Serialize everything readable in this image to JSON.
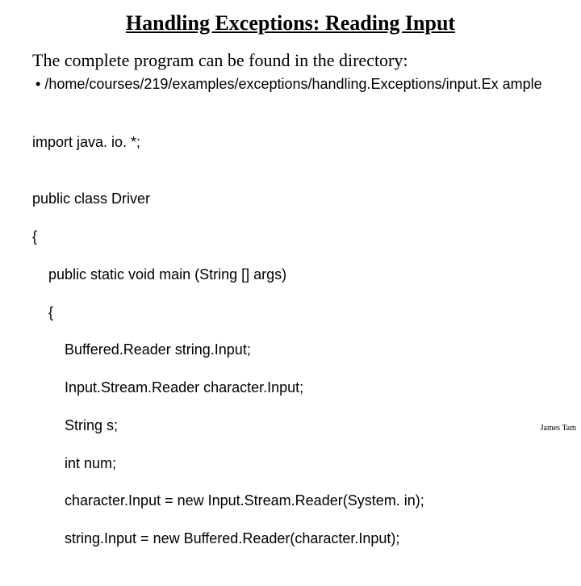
{
  "title": "Handling Exceptions: Reading Input",
  "intro": "The complete program can be found in the directory:",
  "bullet": "/home/courses/219/examples/exceptions/handling.Exceptions/input.Ex ample",
  "code": {
    "l1": "import java. io. *;",
    "l2": "",
    "l3": "public class Driver",
    "l4": "{",
    "l5": "    public static void main (String [] args)",
    "l6": "    {",
    "l7": "        Buffered.Reader string.Input;",
    "l8": "        Input.Stream.Reader character.Input;",
    "l9": "        String s;",
    "l10": "        int num;",
    "l11": "        character.Input = new Input.Stream.Reader(System. in);",
    "l12": "        string.Input = new Buffered.Reader(character.Input);"
  },
  "footer": "James Tam"
}
